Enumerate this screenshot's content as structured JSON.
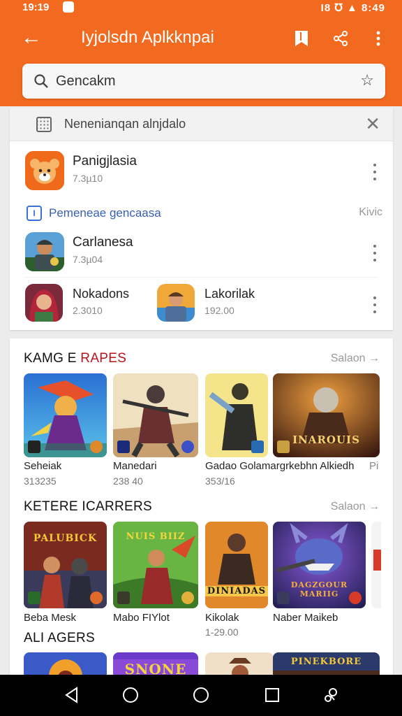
{
  "colors": {
    "brand": "#f26a1f",
    "accent_red": "#b9141c",
    "link_blue": "#3a5fb0"
  },
  "status": {
    "time": "19:19",
    "right": "Ɩ8 ℧ ▲ 8:49"
  },
  "appbar": {
    "title": "Iyjolsdn Aplkknpai",
    "back_icon": "arrow-left-icon",
    "actions": [
      "bookmark-icon",
      "share-icon",
      "more-vert-icon"
    ]
  },
  "search": {
    "value": "Gencakm",
    "icon": "search-icon",
    "star_icon": "star-icon"
  },
  "banner": {
    "text": "Nenenianqan alnjdalo",
    "close": "✕"
  },
  "apps": [
    {
      "name": "Panigjlasia",
      "size": "7.3µ10"
    },
    {
      "name": "Carlanesa",
      "size": "7.3µ04"
    }
  ],
  "section_label": {
    "text": "Pemeneae gencaasa",
    "right": "Kivic"
  },
  "half_apps": [
    {
      "name": "Nokadons",
      "size": "2.3010"
    },
    {
      "name": "Lakorilak",
      "size": "192.00"
    }
  ],
  "games_section": {
    "title_black": "KAMG E ",
    "title_red": "RAPES",
    "see_all": "Salaon →",
    "items": [
      {
        "caption": "Seheiak",
        "sub": "313235"
      },
      {
        "caption": "Manedari",
        "sub": "238 40"
      },
      {
        "caption": "Gadao Golamargrkebhn Alkiedh",
        "sub": "353/16"
      },
      {
        "caption": "Pi",
        "sub": ""
      }
    ],
    "tile_titles": [
      "",
      "",
      "",
      "INAROUIS"
    ]
  },
  "carrers_section": {
    "title": "KETERE ICARRERS",
    "see_all": "Salaon →",
    "items": [
      {
        "caption": "Beba Mesk",
        "sub": ""
      },
      {
        "caption": "Mabo FIYlot",
        "sub": ""
      },
      {
        "caption": "Kikolak",
        "sub": "1-29.00"
      },
      {
        "caption": "Naber Maikeb",
        "sub": ""
      }
    ],
    "tile_titles": [
      "PALUBICK",
      "NUIS BIIZ",
      "DINIADAS",
      "DAGZGOUR MARIIG"
    ]
  },
  "agers_section": {
    "title": "ALI AGERS",
    "tile_titles": [
      "",
      "SNONE",
      "",
      "PINEKBORE"
    ]
  },
  "nav": [
    "back-icon",
    "home-icon",
    "home-circle-icon",
    "recents-icon",
    "assistant-icon"
  ]
}
